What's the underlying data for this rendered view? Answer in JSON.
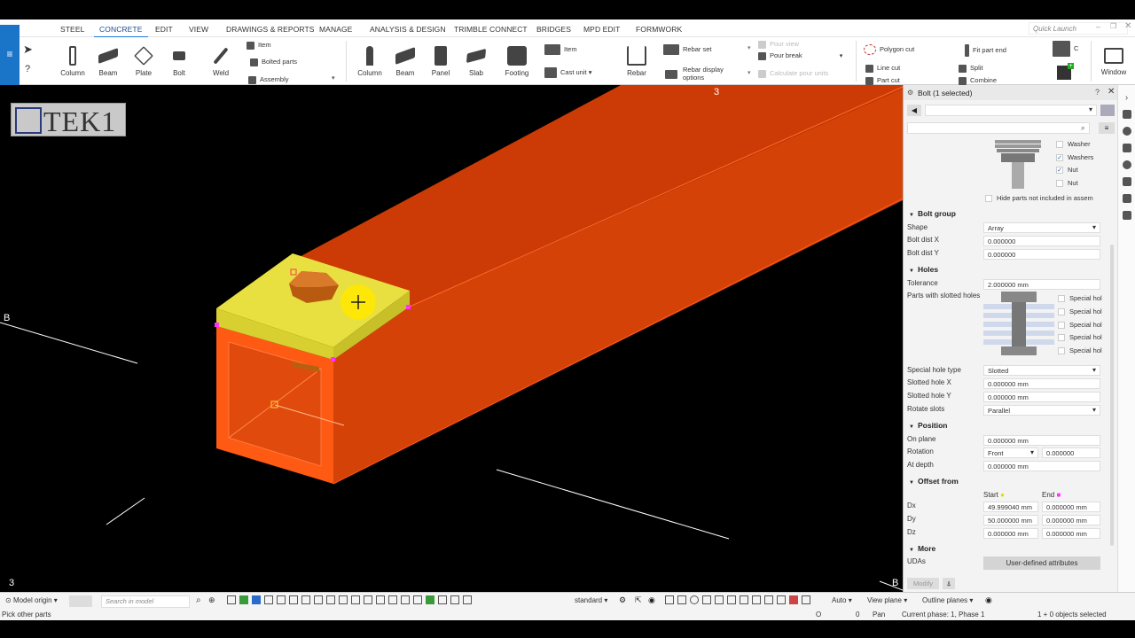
{
  "menu": {
    "tabs": [
      "STEEL",
      "CONCRETE",
      "EDIT",
      "VIEW",
      "DRAWINGS & REPORTS",
      "MANAGE",
      "ANALYSIS & DESIGN",
      "TRIMBLE CONNECT",
      "BRIDGES",
      "MPD EDIT",
      "FORMWORK"
    ],
    "active_tab": "CONCRETE",
    "quick_launch": "Quick Launch"
  },
  "ribbon": {
    "steel": {
      "column": "Column",
      "beam": "Beam",
      "plate": "Plate",
      "bolt": "Bolt",
      "weld": "Weld",
      "item": "Item",
      "bolted_parts": "Bolted parts",
      "assembly": "Assembly"
    },
    "concrete": {
      "column": "Column",
      "beam": "Beam",
      "panel": "Panel",
      "slab": "Slab",
      "footing": "Footing",
      "item": "Item",
      "cast_unit": "Cast unit",
      "rebar": "Rebar",
      "rebar_set": "Rebar set",
      "rebar_display": "Rebar display options",
      "pour_view": "Pour view",
      "pour_break": "Pour break",
      "calc_units": "Calculate pour units"
    },
    "edit": {
      "polygon_cut": "Polygon cut",
      "line_cut": "Line cut",
      "part_cut": "Part cut",
      "fit_part_end": "Fit part end",
      "split": "Split",
      "combine": "Combine",
      "c": "C",
      "window": "Window"
    }
  },
  "viewport": {
    "logo_text": "TEK1",
    "grid_labels": {
      "top_3": "3",
      "left_b": "B",
      "bottom_3": "3",
      "right_b": "B"
    },
    "colors": {
      "member": "#ff5a14",
      "member_far": "#cc3a05",
      "plate": "#e8e040",
      "bolt": "#c86010"
    }
  },
  "panel": {
    "title": "Bolt (1 selected)",
    "washer": "Washer",
    "washers": "Washers",
    "nut1": "Nut",
    "nut2": "Nut",
    "hide_parts": "Hide parts not included in assem",
    "bolt_group": {
      "section": "Bolt group",
      "shape_label": "Shape",
      "shape_value": "Array",
      "dist_x_label": "Bolt dist X",
      "dist_x_value": "0.000000",
      "dist_y_label": "Bolt dist Y",
      "dist_y_value": "0.000000"
    },
    "holes": {
      "section": "Holes",
      "tolerance_label": "Tolerance",
      "tolerance_value": "2.000000 mm",
      "slotted_label": "Parts with slotted holes",
      "special_hole": "Special hol",
      "type_label": "Special hole type",
      "type_value": "Slotted",
      "slot_x_label": "Slotted hole X",
      "slot_x_value": "0.000000 mm",
      "slot_y_label": "Slotted hole Y",
      "slot_y_value": "0.000000 mm",
      "rotate_label": "Rotate slots",
      "rotate_value": "Parallel"
    },
    "position": {
      "section": "Position",
      "on_plane_label": "On plane",
      "on_plane_value": "0.000000 mm",
      "rotation_label": "Rotation",
      "rotation_value": "Front",
      "rotation_num": "0.000000",
      "at_depth_label": "At depth",
      "at_depth_value": "0.000000 mm"
    },
    "offset": {
      "section": "Offset from",
      "start": "Start",
      "end": "End",
      "dx_label": "Dx",
      "dx_start": "49.999040 mm",
      "dx_end": "0.000000 mm",
      "dy_label": "Dy",
      "dy_start": "50.000000 mm",
      "dy_end": "0.000000 mm",
      "dz_label": "Dz",
      "dz_start": "0.000000 mm",
      "dz_end": "0.000000 mm"
    },
    "more": {
      "section": "More",
      "udas_label": "UDAs",
      "udas_button": "User-defined attributes"
    },
    "modify_button": "Modify"
  },
  "status": {
    "model_origin": "Model origin",
    "search": "Search in model",
    "standard": "standard",
    "auto": "Auto",
    "view_plane": "View plane",
    "outline_planes": "Outline planes",
    "prompt": "Pick other parts",
    "o_label": "O",
    "zero": "0",
    "pan": "Pan",
    "phase": "Current phase: 1, Phase 1",
    "selected": "1 + 0 objects selected"
  }
}
